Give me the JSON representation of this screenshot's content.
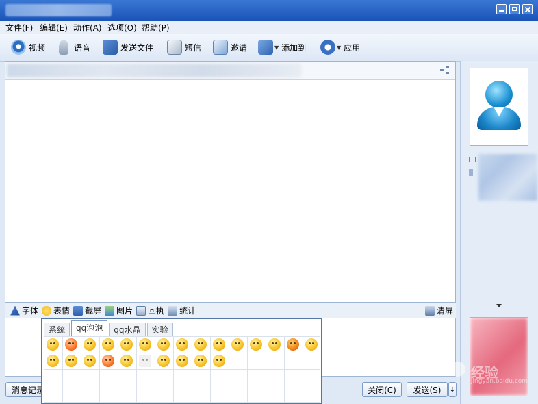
{
  "menu": {
    "file": "文件(F)",
    "edit": "编辑(E)",
    "action": "动作(A)",
    "options": "选项(O)",
    "help": "帮助(P)"
  },
  "toolbar": {
    "video": "视频",
    "voice": "语音",
    "send_file": "发送文件",
    "sms": "短信",
    "invite": "邀请",
    "add_to": "添加到",
    "apps": "应用"
  },
  "input_toolbar": {
    "font": "字体",
    "emoticon": "表情",
    "screenshot": "截屏",
    "picture": "图片",
    "receipt": "回执",
    "stats": "统计",
    "clear": "清屏"
  },
  "emoji_panel": {
    "tabs": [
      "系统",
      "qq泡泡",
      "qq水晶",
      "实验"
    ],
    "active_tab": "qq泡泡"
  },
  "buttons": {
    "history": "消息记录",
    "close": "关闭(C)",
    "send": "发送(S)",
    "send_options": "↓"
  },
  "watermark": {
    "brand": "Bai",
    "brand2": "经验",
    "url": "jingyan.baidu.com"
  }
}
